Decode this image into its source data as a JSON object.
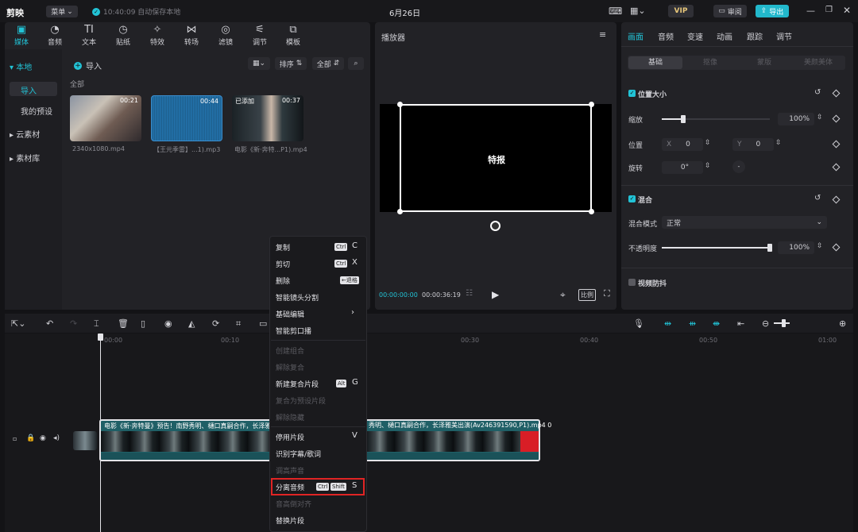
{
  "app": {
    "logo": "剪映",
    "menu": "菜单",
    "autosave": "10:40:09 自动保存本地",
    "title": "6月26日",
    "vip": "VIP",
    "review": "审阅",
    "export": "导出"
  },
  "tools": [
    {
      "label": "媒体",
      "icon": "media-icon"
    },
    {
      "label": "音频",
      "icon": "audio-icon"
    },
    {
      "label": "文本",
      "icon": "text-icon"
    },
    {
      "label": "贴纸",
      "icon": "sticker-icon"
    },
    {
      "label": "特效",
      "icon": "effects-icon"
    },
    {
      "label": "转场",
      "icon": "transition-icon"
    },
    {
      "label": "滤镜",
      "icon": "filter-icon"
    },
    {
      "label": "调节",
      "icon": "adjust-icon"
    },
    {
      "label": "模板",
      "icon": "template-icon"
    }
  ],
  "sidebar": {
    "local": "本地",
    "import": "导入",
    "presets": "我的预设",
    "cloud": "云素材",
    "library": "素材库"
  },
  "media": {
    "import_label": "导入",
    "sort_label": "排序",
    "all_label": "全部",
    "all_header": "全部",
    "items": [
      {
        "duration": "00:21",
        "caption": "2340x1080.mp4",
        "badge": ""
      },
      {
        "duration": "00:44",
        "caption": "【王元季雷】...1).mp3",
        "badge": ""
      },
      {
        "duration": "00:37",
        "caption": "电影《新·奔特...P1).mp4",
        "badge": "已添加"
      }
    ]
  },
  "player": {
    "title": "播放器",
    "overlay_text": "特报",
    "current_time": "00:00:00:00",
    "total_time": "00:00:36:19",
    "ratio": "比例"
  },
  "inspector": {
    "tabs": [
      "画面",
      "音频",
      "变速",
      "动画",
      "跟踪",
      "调节"
    ],
    "subtabs": [
      "基础",
      "抠像",
      "蒙版",
      "美颜美体"
    ],
    "position_size": "位置大小",
    "scale_label": "缩放",
    "scale_value": "100%",
    "scale_fraction": 0.2,
    "position_label": "位置",
    "pos_x_label": "X",
    "pos_x": "0",
    "pos_y_label": "Y",
    "pos_y": "0",
    "rotate_label": "旋转",
    "rotate_value": "0°",
    "blend_section": "混合",
    "blend_mode_label": "混合模式",
    "blend_mode_value": "正常",
    "opacity_label": "不透明度",
    "opacity_value": "100%",
    "opacity_fraction": 1.0,
    "stabilize": "视频防抖"
  },
  "context_menu": {
    "items": [
      {
        "label": "复制",
        "keys": [
          "Ctrl"
        ],
        "letter": "C",
        "disabled": false
      },
      {
        "label": "剪切",
        "keys": [
          "Ctrl"
        ],
        "letter": "X",
        "disabled": false
      },
      {
        "label": "删除",
        "keys": [
          "←退格"
        ],
        "letter": "",
        "disabled": false
      },
      {
        "label": "智能镜头分割",
        "keys": [],
        "letter": "",
        "disabled": false
      },
      {
        "label": "基础编辑",
        "keys": [],
        "letter": "",
        "disabled": false,
        "submenu": true
      },
      {
        "label": "智能剪口播",
        "keys": [],
        "letter": "",
        "disabled": false
      },
      {
        "label": "创建组合",
        "keys": [],
        "letter": "",
        "disabled": true
      },
      {
        "label": "解除复合",
        "keys": [],
        "letter": "",
        "disabled": true
      },
      {
        "label": "新建复合片段",
        "keys": [
          "Alt"
        ],
        "letter": "G",
        "disabled": false
      },
      {
        "label": "复合为预设片段",
        "keys": [],
        "letter": "",
        "disabled": true
      },
      {
        "label": "解除隐藏",
        "keys": [],
        "letter": "",
        "disabled": true
      },
      {
        "label": "停用片段",
        "keys": [],
        "letter": "V",
        "disabled": false
      },
      {
        "label": "识别字幕/歌词",
        "keys": [],
        "letter": "",
        "disabled": false
      },
      {
        "label": "调高声音",
        "keys": [],
        "letter": "",
        "disabled": true
      },
      {
        "label": "分离音频",
        "keys": [
          "Ctrl",
          "Shift"
        ],
        "letter": "S",
        "disabled": false,
        "highlighted": true
      },
      {
        "label": "音高倒对齐",
        "keys": [],
        "letter": "",
        "disabled": true
      },
      {
        "label": "替换片段",
        "keys": [],
        "letter": "",
        "disabled": false
      }
    ]
  },
  "timeline": {
    "ruler": [
      "00:00",
      "00:10",
      "00:30",
      "00:40",
      "00:50",
      "01:00"
    ],
    "clip_title_left": "电影《新·奔特曼》预告！南野秀明、樋口真嗣合作，长泽雅美",
    "clip_title_right": "秀明、樋口真嗣合作，长泽雅美出演(Av246391590,P1).mp4  0"
  }
}
